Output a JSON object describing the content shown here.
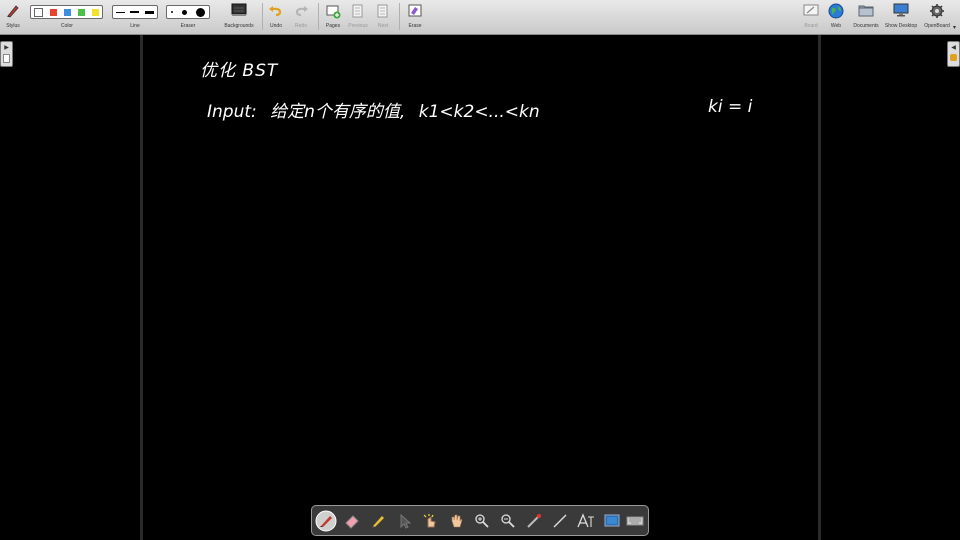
{
  "toolbar": {
    "stylus": "Stylus",
    "color": "Color",
    "line": "Line",
    "eraser": "Eraser",
    "backgrounds": "Backgrounds",
    "undo": "Undo",
    "redo": "Redo",
    "pages": "Pages",
    "previous": "Previous",
    "next": "Next",
    "erase": "Erase",
    "board": "Board",
    "web": "Web",
    "documents": "Documents",
    "show_desktop": "Show Desktop",
    "openboard": "OpenBoard"
  },
  "colors": {
    "swatches": [
      "#ffffff",
      "#e8432e",
      "#3d8de0",
      "#4dc04b",
      "#f2e12a"
    ],
    "toolbar_bg": "#d9d9d9",
    "board_bg": "#000000",
    "ink": "#ffffff"
  },
  "board": {
    "title": "优化 BST",
    "input_line": "Input: 给定n个有序的值, k1<k2<...<kn",
    "input_label": "Input:",
    "input_text_cn": "给定n个有序的值,",
    "sequence": "k1<k2<...<kn",
    "ki": "ki = i"
  },
  "dock": {
    "tools": [
      "pen-tool-icon",
      "eraser-tool-icon",
      "marker-tool-icon",
      "selector-tool-icon",
      "interactor-tool-icon",
      "hand-tool-icon",
      "zoom-in-tool-icon",
      "zoom-out-tool-icon",
      "laser-pointer-icon",
      "line-tool-icon",
      "text-tool-icon",
      "capture-tool-icon",
      "keyboard-icon"
    ]
  }
}
